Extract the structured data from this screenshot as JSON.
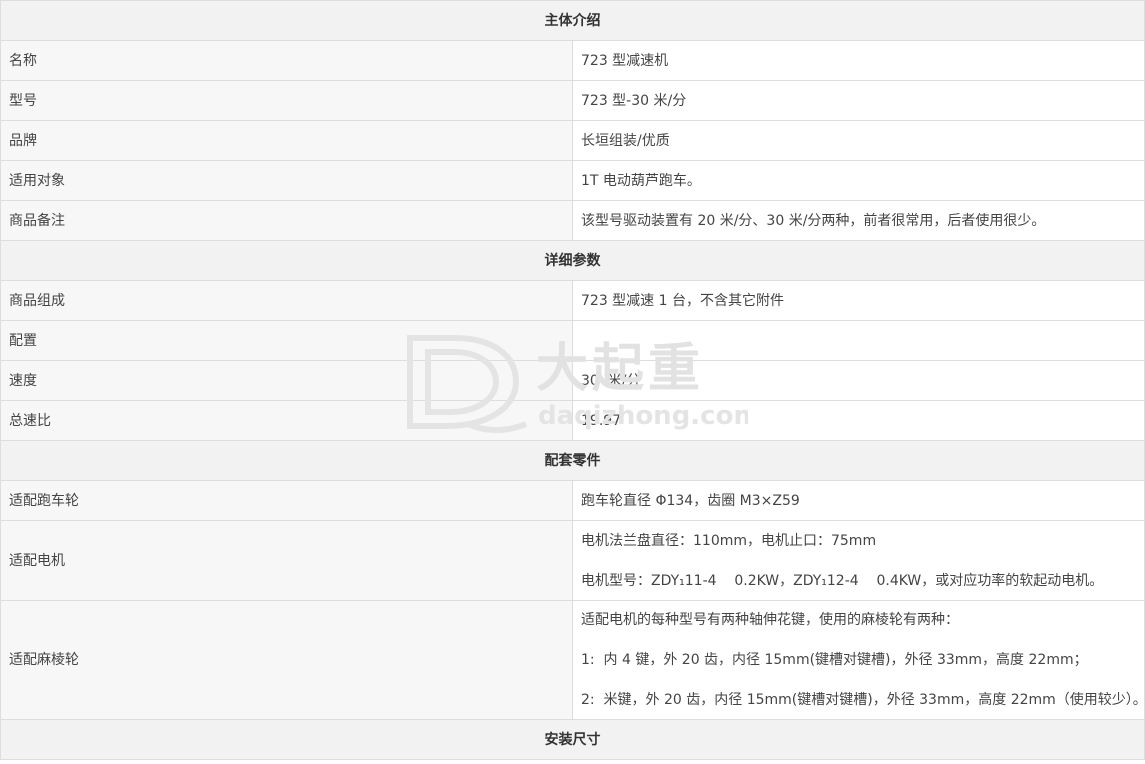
{
  "sections": {
    "intro": "主体介绍",
    "params": "详细参数",
    "parts": "配套零件",
    "install": "安装尺寸"
  },
  "intro_rows": [
    {
      "label": "名称",
      "value": "723 型减速机"
    },
    {
      "label": "型号",
      "value": "723 型-30 米/分"
    },
    {
      "label": "品牌",
      "value": "长垣组装/优质"
    },
    {
      "label": "适用对象",
      "value": "1T 电动葫芦跑车。"
    },
    {
      "label": "商品备注",
      "value": "该型号驱动装置有 20 米/分、30 米/分两种，前者很常用，后者使用很少。"
    }
  ],
  "param_rows": [
    {
      "label": "商品组成",
      "value": "723 型减速 1 台，不含其它附件"
    },
    {
      "label": "配置",
      "value": ""
    },
    {
      "label": "速度",
      "value": "30  米/分"
    },
    {
      "label": "总速比",
      "value": "19.97"
    }
  ],
  "parts_rows": {
    "wheel": {
      "label": "适配跑车轮",
      "value": "跑车轮直径 Φ134，齿圈 M3×Z59"
    },
    "motor": {
      "label": "适配电机",
      "line1": "电机法兰盘直径：110mm，电机止口：75mm",
      "line2": "电机型号：ZDY₁11-4    0.2KW，ZDY₁12-4    0.4KW，或对应功率的软起动电机。"
    },
    "gear": {
      "label": "适配麻棱轮",
      "line1": "适配电机的每种型号有两种轴伸花键，使用的麻棱轮有两种：",
      "line2": "1:  内 4 键，外 20 齿，内径 15mm(键槽对键槽)，外径 33mm，高度 22mm；",
      "line3": "2:  米键，外 20 齿，内径 15mm(键槽对键槽)，外径 33mm，高度 22mm（使用较少）。"
    }
  },
  "watermark": {
    "brand": "大起重",
    "domain": "daqizhong.com",
    "color": "#e6e6e6"
  }
}
